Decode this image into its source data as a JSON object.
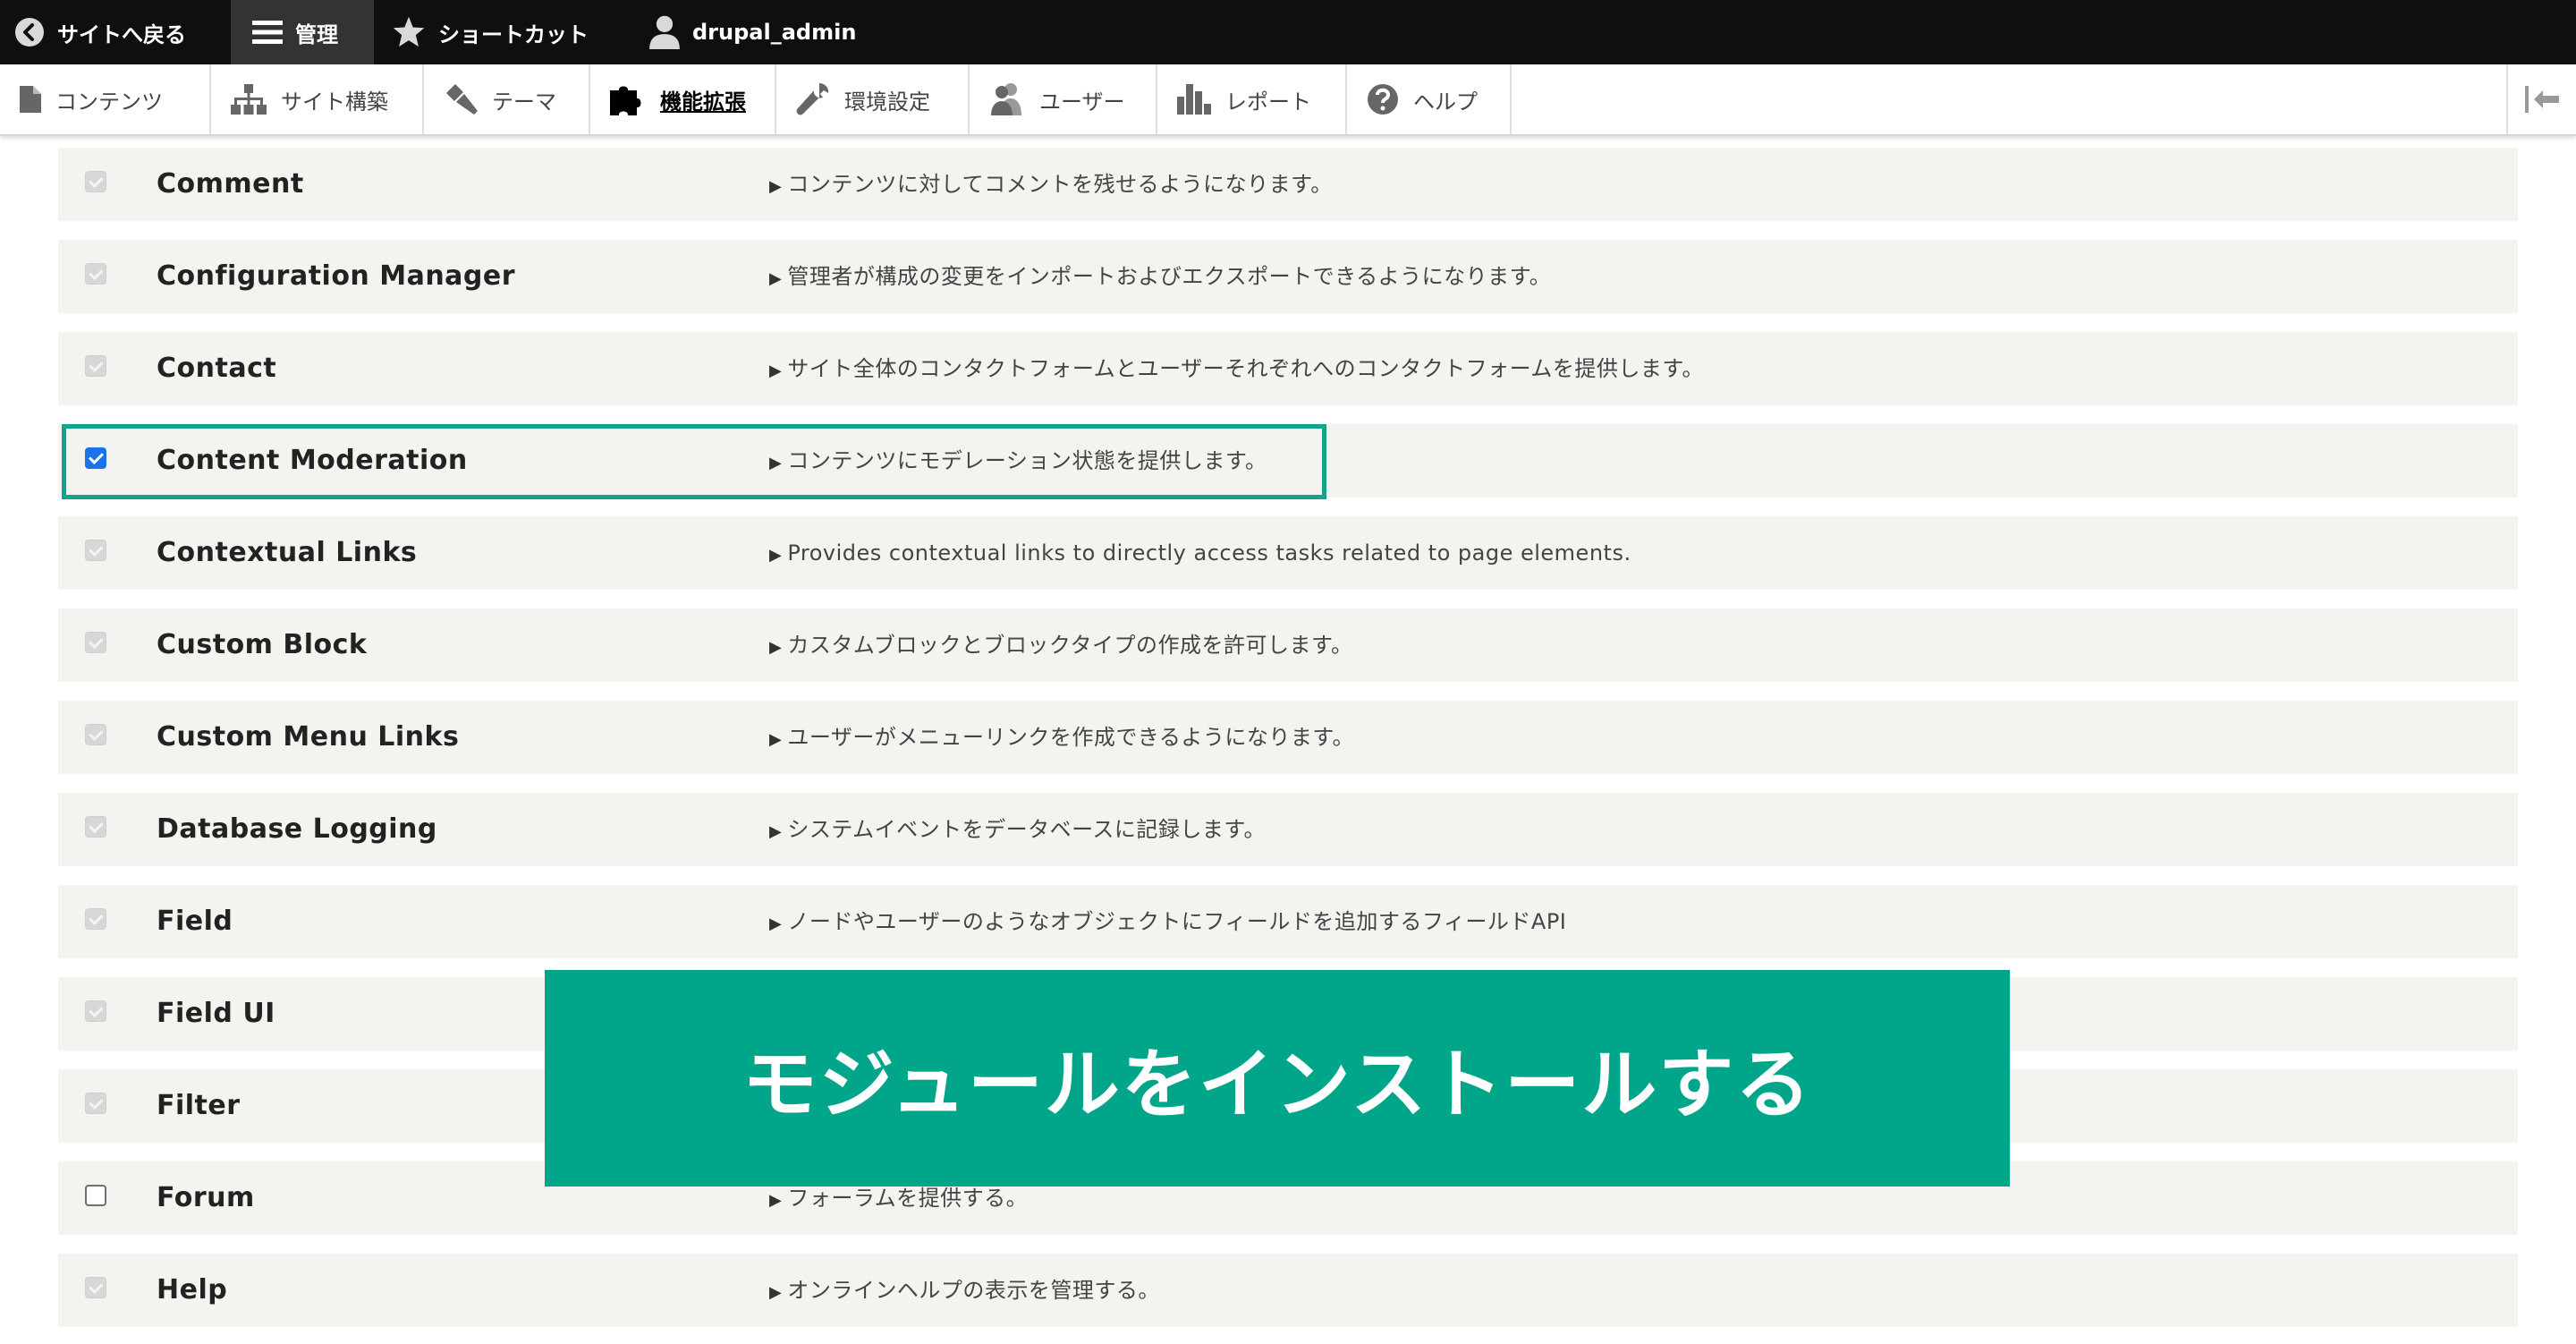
{
  "toolbar": {
    "back_to_site": "サイトへ戻る",
    "manage": "管理",
    "shortcuts": "ショートカット",
    "user": "drupal_admin"
  },
  "admin_menu": {
    "content": "コンテンツ",
    "structure": "サイト構築",
    "appearance": "テーマ",
    "extend": "機能拡張",
    "configuration": "環境設定",
    "people": "ユーザー",
    "reports": "レポート",
    "help": "ヘルプ"
  },
  "modules": [
    {
      "name": "Comment",
      "description": "コンテンツに対してコメントを残せるようになります。",
      "state": "disabled"
    },
    {
      "name": "Configuration Manager",
      "description": "管理者が構成の変更をインポートおよびエクスポートできるようになります。",
      "state": "disabled"
    },
    {
      "name": "Contact",
      "description": "サイト全体のコンタクトフォームとユーザーそれぞれへのコンタクトフォームを提供します。",
      "state": "disabled"
    },
    {
      "name": "Content Moderation",
      "description": "コンテンツにモデレーション状態を提供します。",
      "state": "checked"
    },
    {
      "name": "Contextual Links",
      "description": "Provides contextual links to directly access tasks related to page elements.",
      "state": "disabled"
    },
    {
      "name": "Custom Block",
      "description": "カスタムブロックとブロックタイプの作成を許可します。",
      "state": "disabled"
    },
    {
      "name": "Custom Menu Links",
      "description": "ユーザーがメニューリンクを作成できるようになります。",
      "state": "disabled"
    },
    {
      "name": "Database Logging",
      "description": "システムイベントをデータベースに記録します。",
      "state": "disabled"
    },
    {
      "name": "Field",
      "description": "ノードやユーザーのようなオブジェクトにフィールドを追加するフィールドAPI",
      "state": "disabled"
    },
    {
      "name": "Field UI",
      "description": "",
      "state": "disabled"
    },
    {
      "name": "Filter",
      "description": "",
      "state": "disabled"
    },
    {
      "name": "Forum",
      "description": "フォーラムを提供する。",
      "state": "unchecked"
    },
    {
      "name": "Help",
      "description": "オンラインヘルプの表示を管理する。",
      "state": "disabled"
    }
  ],
  "overlay": {
    "caption": "モジュールをインストールする",
    "color": "#00a58a"
  },
  "colors": {
    "highlight": "#13a38a",
    "checkbox_checked": "#1a73e8"
  }
}
